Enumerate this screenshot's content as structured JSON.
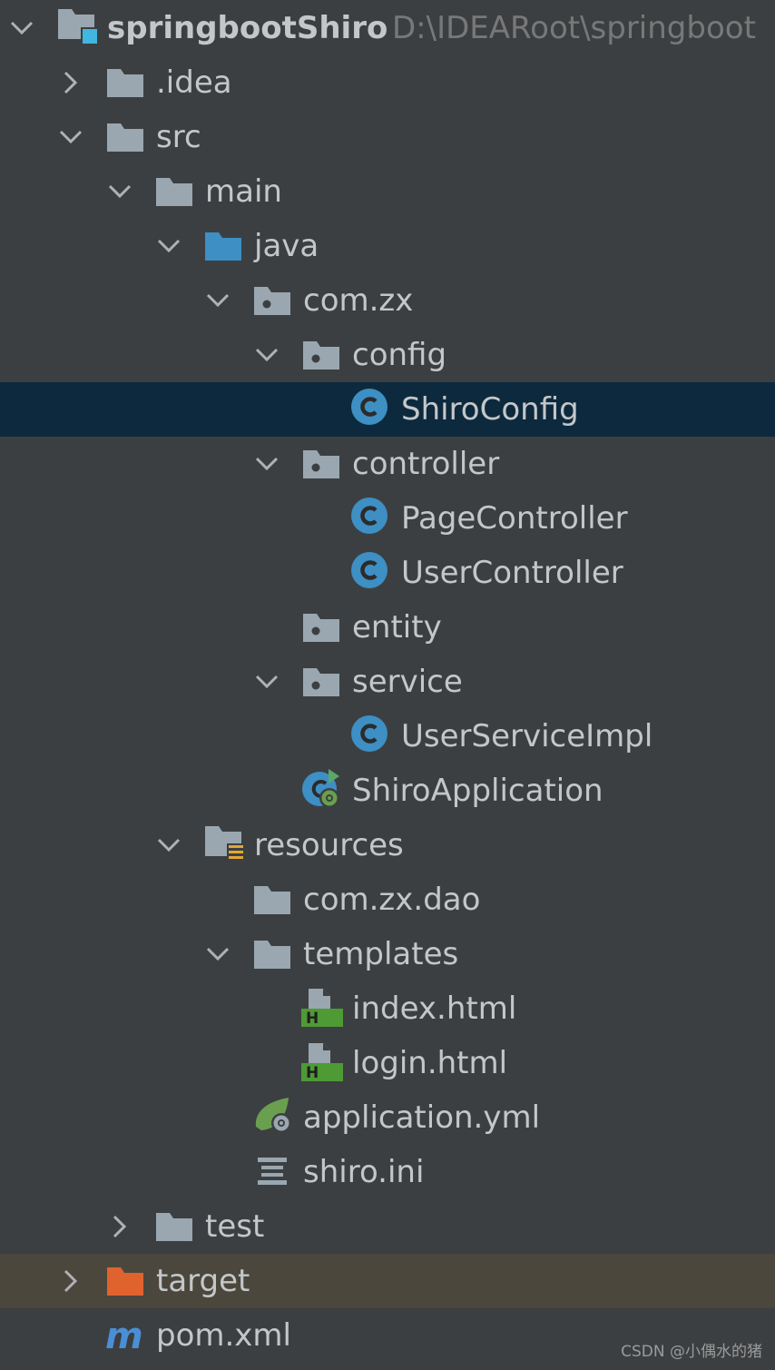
{
  "project": {
    "name": "springbootShiro",
    "path": "D:\\IDEARoot\\springboot"
  },
  "tree": [
    {
      "label": "springbootShiro",
      "depth": 0,
      "expanded": true,
      "icon": "module-icon",
      "bold": true,
      "hint": "D:\\IDEARoot\\springboot"
    },
    {
      "label": ".idea",
      "depth": 1,
      "expanded": false,
      "icon": "folder-icon"
    },
    {
      "label": "src",
      "depth": 1,
      "expanded": true,
      "icon": "folder-icon"
    },
    {
      "label": "main",
      "depth": 2,
      "expanded": true,
      "icon": "folder-icon"
    },
    {
      "label": "java",
      "depth": 3,
      "expanded": true,
      "icon": "source-folder-icon"
    },
    {
      "label": "com.zx",
      "depth": 4,
      "expanded": true,
      "icon": "package-icon"
    },
    {
      "label": "config",
      "depth": 5,
      "expanded": true,
      "icon": "package-icon"
    },
    {
      "label": "ShiroConfig",
      "depth": 6,
      "icon": "class-icon",
      "selected": true
    },
    {
      "label": "controller",
      "depth": 5,
      "expanded": true,
      "icon": "package-icon"
    },
    {
      "label": "PageController",
      "depth": 6,
      "icon": "class-icon"
    },
    {
      "label": "UserController",
      "depth": 6,
      "icon": "class-icon"
    },
    {
      "label": "entity",
      "depth": 5,
      "icon": "package-icon"
    },
    {
      "label": "service",
      "depth": 5,
      "expanded": true,
      "icon": "package-icon"
    },
    {
      "label": "UserServiceImpl",
      "depth": 6,
      "icon": "class-icon"
    },
    {
      "label": "ShiroApplication",
      "depth": 5,
      "icon": "spring-boot-app-icon"
    },
    {
      "label": "resources",
      "depth": 3,
      "expanded": true,
      "icon": "resources-folder-icon"
    },
    {
      "label": "com.zx.dao",
      "depth": 4,
      "icon": "folder-icon"
    },
    {
      "label": "templates",
      "depth": 4,
      "expanded": true,
      "icon": "folder-icon"
    },
    {
      "label": "index.html",
      "depth": 5,
      "icon": "html-file-icon"
    },
    {
      "label": "login.html",
      "depth": 5,
      "icon": "html-file-icon"
    },
    {
      "label": "application.yml",
      "depth": 4,
      "icon": "spring-yml-icon"
    },
    {
      "label": "shiro.ini",
      "depth": 4,
      "icon": "ini-file-icon"
    },
    {
      "label": "test",
      "depth": 2,
      "expanded": false,
      "icon": "folder-icon"
    },
    {
      "label": "target",
      "depth": 1,
      "expanded": false,
      "icon": "excluded-folder-icon",
      "excluded": true
    },
    {
      "label": "pom.xml",
      "depth": 1,
      "icon": "maven-icon"
    }
  ],
  "colors": {
    "background": "#3c3f41",
    "selection": "#0d293e",
    "excluded_row": "#4b473d",
    "text": "#c4c7c9",
    "folder": "#9aa7b0",
    "source_folder": "#3d8fc4",
    "class_badge": "#3d8fc4",
    "excluded_folder": "#e0632e",
    "html_badge": "#4e9a35",
    "spring_green": "#6a9f4f",
    "maven": "#4a8fd6"
  },
  "watermark": "CSDN @小偶水的猪"
}
